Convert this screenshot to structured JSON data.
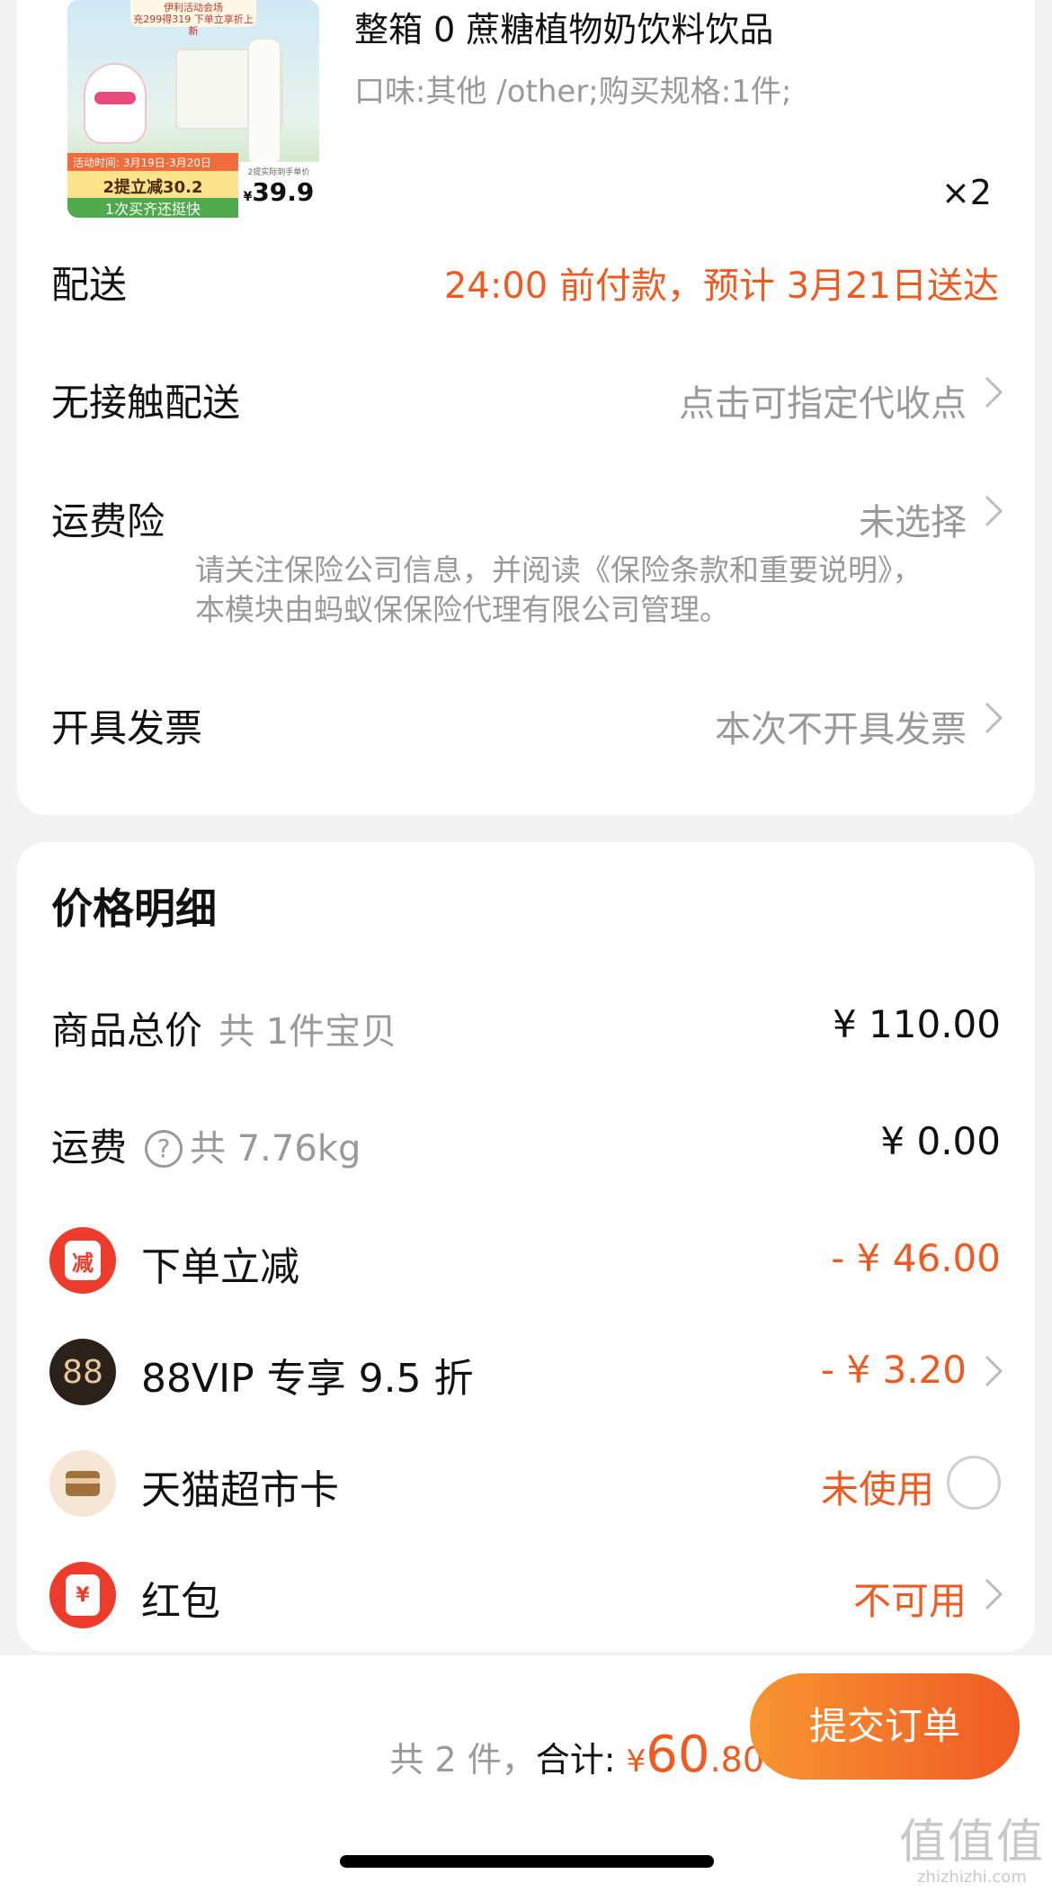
{
  "product": {
    "title_line2": "整箱 0 蔗糖植物奶饮料饮品",
    "sku": "口味:其他 /other;购买规格:1件;",
    "qty": "×2",
    "thumb": {
      "banner_line1": "伊利活动会场",
      "banner_line2": "充299得319 下单立享折上新",
      "promo_date": "活动时间: 3月19日-3月20日",
      "promo_offer": "2提立减30.2",
      "promo_sub": "1次买齐还挺快",
      "price_note": "2提实际到手单价",
      "price": "39.9",
      "currency": "¥"
    }
  },
  "order_rows": {
    "delivery": {
      "label": "配送",
      "value": "24:00 前付款，预计 3月21日送达"
    },
    "contactless": {
      "label": "无接触配送",
      "value": "点击可指定代收点"
    },
    "shipping_insurance": {
      "label": "运费险",
      "value": "未选择",
      "note": "请关注保险公司信息，并阅读《保险条款和重要说明》，本模块由蚂蚁保保险代理有限公司管理。"
    },
    "invoice": {
      "label": "开具发票",
      "value": "本次不开具发票"
    }
  },
  "price_detail": {
    "title": "价格明细",
    "goods_total": {
      "label": "商品总价",
      "sub": "共 1件宝贝",
      "amount": "¥ 110.00"
    },
    "freight": {
      "label": "运费",
      "help": "?",
      "sub": "共 7.76kg",
      "amount": "¥ 0.00"
    },
    "instant_discount": {
      "icon": "减",
      "label": "下单立减",
      "amount": "- ¥ 46.00"
    },
    "vip": {
      "icon": "88",
      "label": "88VIP 专享 9.5 折",
      "amount": "- ¥ 3.20"
    },
    "tmall_card": {
      "label": "天猫超市卡",
      "status": "未使用"
    },
    "red_packet": {
      "icon": "¥",
      "label": "红包",
      "status": "不可用"
    }
  },
  "bottom_bar": {
    "count": "共 2 件，",
    "total_label": "合计:",
    "currency": "¥",
    "total_int": "60",
    "total_dec": ".80",
    "submit_label": "提交订单"
  },
  "watermark": {
    "line1": "值值值",
    "line2": "zhizhizhi.com"
  },
  "colors": {
    "accent": "#ee5a1f",
    "muted": "#999999",
    "background": "#f2f2f2"
  }
}
